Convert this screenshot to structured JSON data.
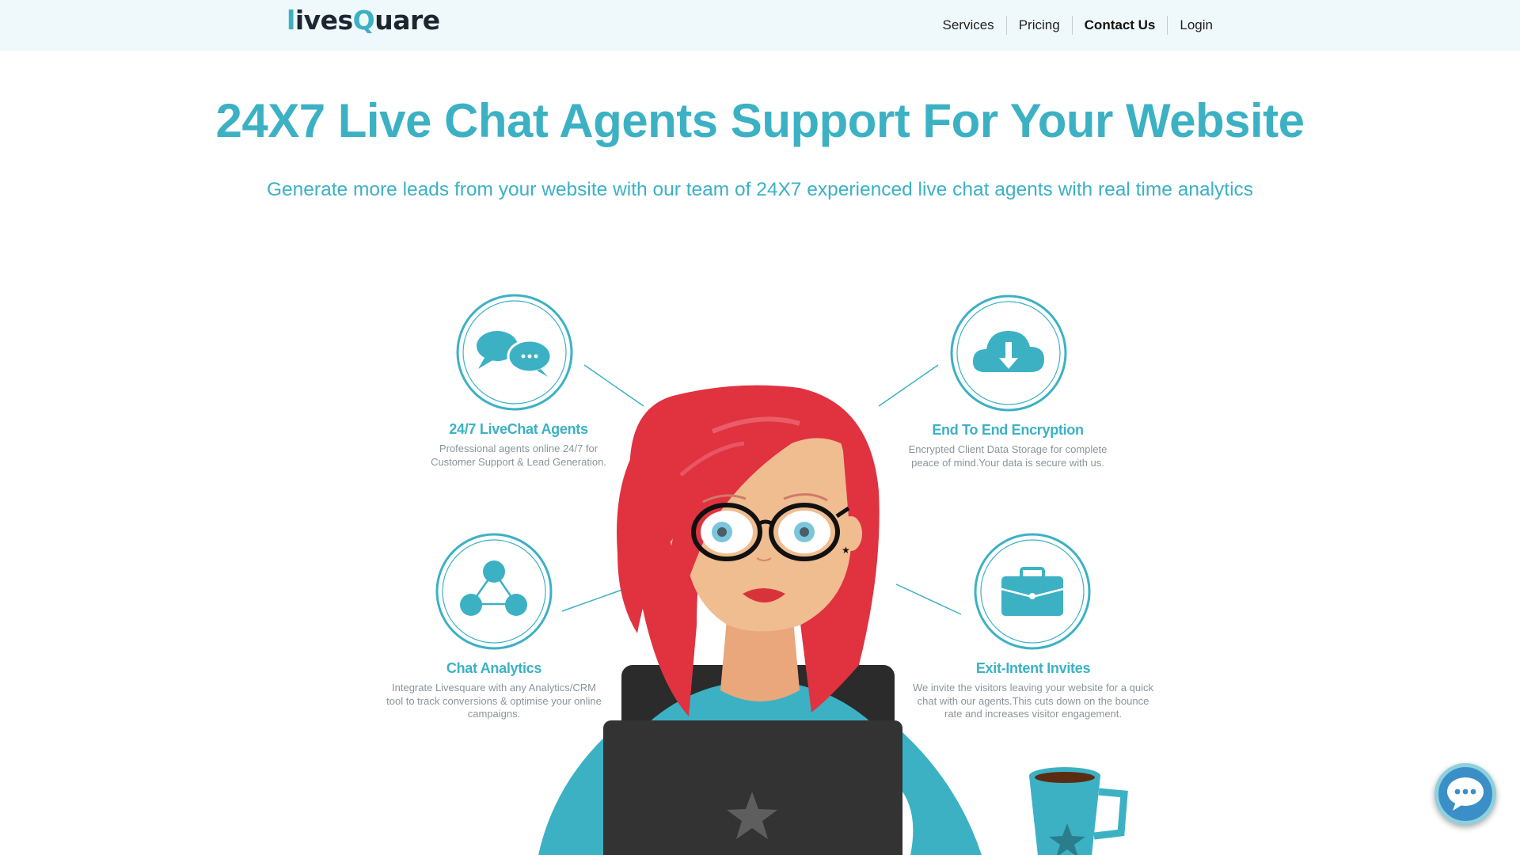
{
  "header": {
    "logo": {
      "lead": "l",
      "part1": "ives",
      "q": "Q",
      "part2": "uare"
    },
    "nav": [
      {
        "label": "Services"
      },
      {
        "label": "Pricing"
      },
      {
        "label": "Contact Us"
      },
      {
        "label": "Login"
      }
    ]
  },
  "hero": {
    "title": "24X7 Live Chat Agents Support For Your Website",
    "subtitle": "Generate more leads from your website with our team of 24X7 experienced live chat agents with real time analytics"
  },
  "features": [
    {
      "title": "24/7 LiveChat Agents",
      "desc": "Professional agents online 24/7 for Customer Support & Lead Generation.",
      "icon": "chat-bubbles-icon"
    },
    {
      "title": "End To End Encryption",
      "desc": "Encrypted Client Data Storage for complete peace of mind.Your data is secure with us.",
      "icon": "cloud-download-icon"
    },
    {
      "title": "Chat Analytics",
      "desc": "Integrate Livesquare with any Analytics/CRM tool to track conversions & optimise your online campaigns.",
      "icon": "network-nodes-icon"
    },
    {
      "title": "Exit-Intent Invites",
      "desc": "We invite the visitors leaving your website for a quick chat with our agents.This cuts down on the bounce rate and increases visitor engagement.",
      "icon": "briefcase-icon"
    }
  ],
  "colors": {
    "accent": "#3cb1c4",
    "header_bg": "#eff9fb",
    "hair": "#e0323f",
    "laptop": "#333333",
    "chat_widget": "#3b8fc7"
  },
  "chat_widget": {
    "icon": "chat-dots-icon"
  }
}
